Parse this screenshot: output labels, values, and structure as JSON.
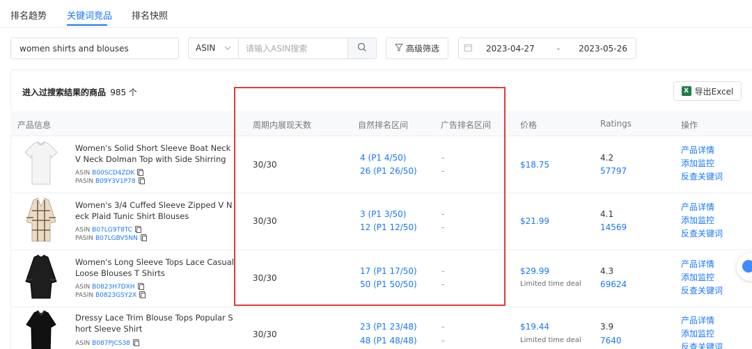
{
  "tabs": [
    {
      "label": "排名趋势"
    },
    {
      "label": "关键词竞品",
      "active": true
    },
    {
      "label": "排名快照"
    }
  ],
  "toolbar": {
    "keyword_value": "women shirts and blouses",
    "asin_select": "ASIN",
    "asin_placeholder": "请输入ASIN搜索",
    "filter_label": "高级筛选",
    "date_start": "2023-04-27",
    "date_sep": "-",
    "date_end": "2023-05-26"
  },
  "summary": {
    "title": "进入过搜索结果的商品",
    "count": "985 个",
    "export_label": "导出Excel"
  },
  "columns": {
    "product": "产品信息",
    "days": "周期内展现天数",
    "organic": "自然排名区间",
    "ad": "广告排名区间",
    "price": "价格",
    "ratings": "Ratings",
    "actions": "操作"
  },
  "rows": [
    {
      "title": "Women's Solid Short Sleeve Boat Neck V Neck Dolman Top with Side Shirring",
      "asin": "B00SCD4ZDK",
      "pasin": "B09Y3V1P78",
      "days": "30/30",
      "organic1": "4 (P1 4/50)",
      "organic2": "26 (P1 26/50)",
      "ad1": "-",
      "ad2": "-",
      "price": "$18.75",
      "deal": "",
      "rating": "4.2",
      "rating_count": "57797"
    },
    {
      "title": "Women's 3/4 Cuffed Sleeve Zipped V Neck Plaid Tunic Shirt Blouses",
      "asin": "B07LG9T8TC",
      "pasin": "B07LGBV5NN",
      "days": "30/30",
      "organic1": "3 (P1 3/50)",
      "organic2": "12 (P1 12/50)",
      "ad1": "-",
      "ad2": "-",
      "price": "$21.99",
      "deal": "",
      "rating": "4.1",
      "rating_count": "14569"
    },
    {
      "title": "Women's Long Sleeve Tops Lace Casual Loose Blouses T Shirts",
      "asin": "B0823H7DXH",
      "pasin": "B0823GSY2X",
      "days": "30/30",
      "organic1": "17 (P1 17/50)",
      "organic2": "50 (P1 50/50)",
      "ad1": "-",
      "ad2": "-",
      "price": "$29.99",
      "deal": "Limited time deal",
      "rating": "4.3",
      "rating_count": "69624"
    },
    {
      "title": "Dressy Lace Trim Blouse Tops Popular Short Sleeve Shirt",
      "asin": "B087PJCS38",
      "pasin": "",
      "days": "30/30",
      "organic1": "23 (P1 23/48)",
      "organic2": "48 (P1 48/48)",
      "ad1": "-",
      "ad2": "-",
      "price": "$19.44",
      "deal": "Limited time deal",
      "rating": "3.9",
      "rating_count": "7640"
    }
  ],
  "labels": {
    "asin": "ASIN",
    "pasin": "PASIN",
    "op_detail": "产品详情",
    "op_monitor": "添加监控",
    "op_reverse": "反查关键词"
  },
  "colors": {
    "accent": "#1677ff",
    "highlight": "#e53935",
    "excel": "#1e7e45"
  }
}
